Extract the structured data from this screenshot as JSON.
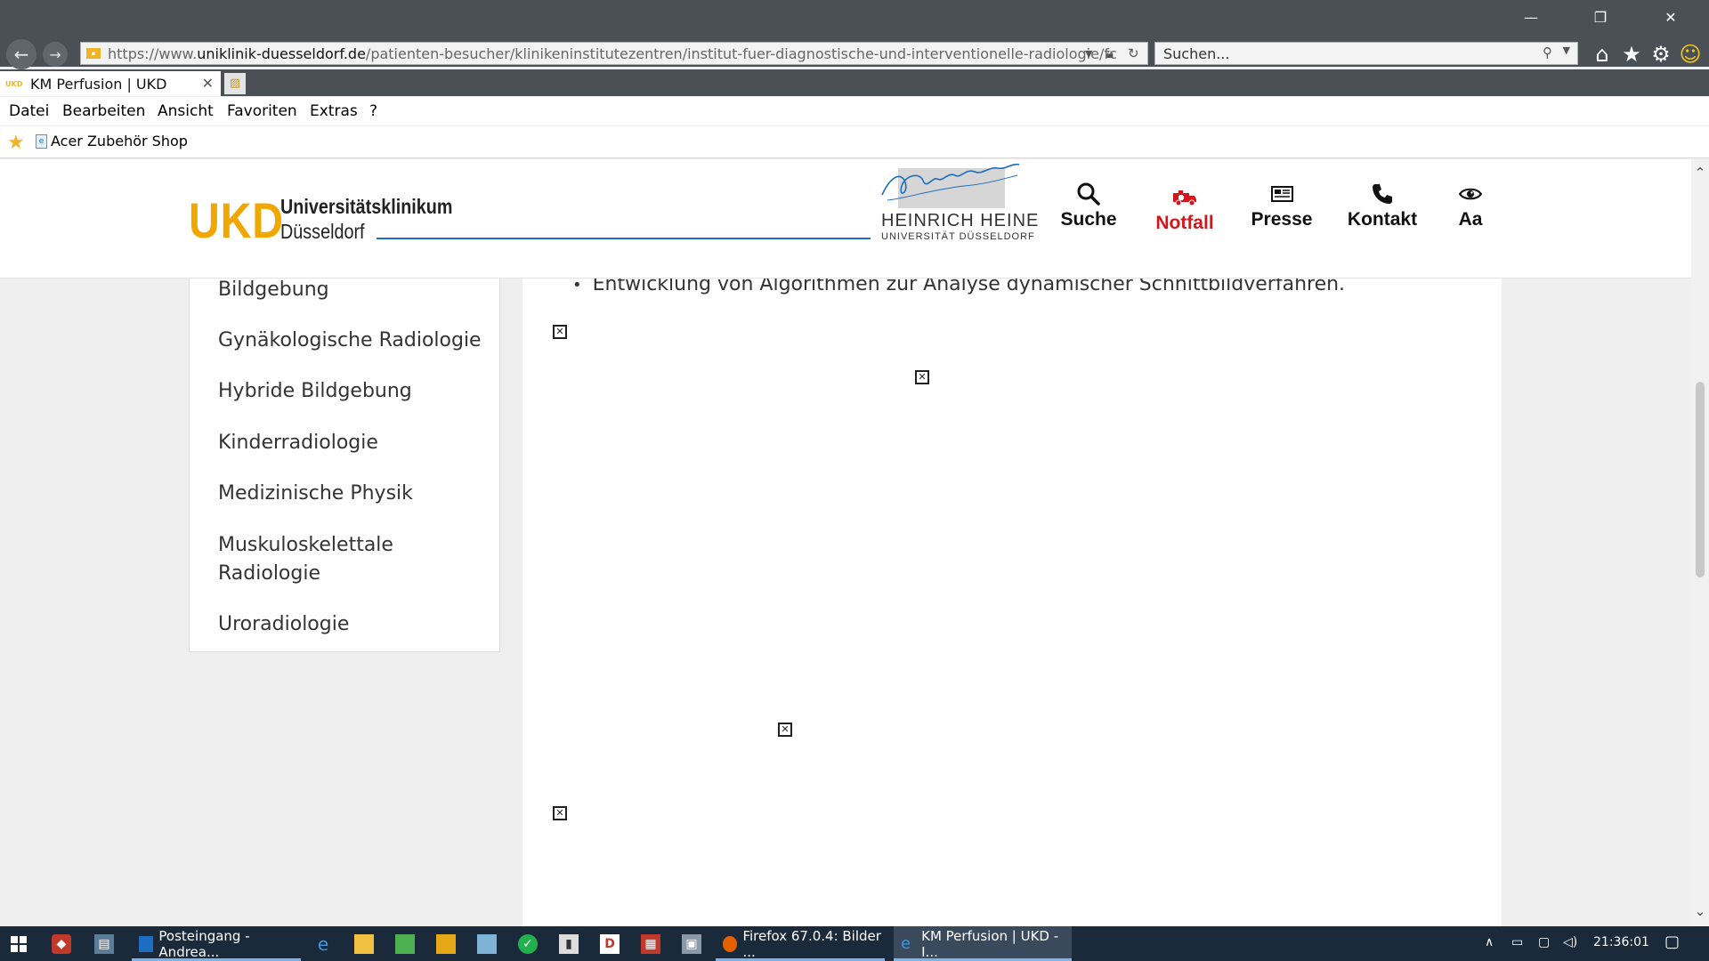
{
  "browser": {
    "url_prefix": "https://www.",
    "url_host": "uniklinik-duesseldorf.de",
    "url_path": "/patienten-besucher/klinikeninstitutezentren/institut-fuer-diagnostische-und-interventionelle-radiologie/fc",
    "search_placeholder": "Suchen...",
    "tab_title": "KM Perfusion | UKD",
    "tab_favicon": "UKD",
    "menu": [
      "Datei",
      "Bearbeiten",
      "Ansicht",
      "Favoriten",
      "Extras",
      "?"
    ],
    "favorites": [
      {
        "label": "Acer Zubehör Shop"
      }
    ]
  },
  "site": {
    "logo_mark": "UKD",
    "logo_line1": "Universitätsklinikum",
    "logo_line2": "Düsseldorf",
    "partner_name": "HEINRICH HEINE",
    "partner_sub": "UNIVERSITÄT DÜSSELDORF",
    "nav": [
      {
        "label": "Suche",
        "icon": "search-icon"
      },
      {
        "label": "Notfall",
        "icon": "ambulance-icon",
        "color": "#d4161c"
      },
      {
        "label": "Presse",
        "icon": "newspaper-icon"
      },
      {
        "label": "Kontakt",
        "icon": "phone-icon"
      },
      {
        "label": "Aa",
        "icon": "eye-icon"
      }
    ]
  },
  "sidebar": {
    "items": [
      "Bildgebung",
      "Gynäkologische Radiologie",
      "Hybride Bildgebung",
      "Kinderradiologie",
      "Medizinische Physik",
      "Muskuloskelettale Radiologie",
      "Uroradiologie"
    ]
  },
  "main": {
    "bullet_text": "Entwicklung von Algorithmen zur Analyse dynamischer Schnittbildverfahren."
  },
  "taskbar": {
    "tasks": [
      {
        "label": "Posteingang - Andrea..."
      },
      {
        "label": "Firefox 67.0.4: Bilder ..."
      },
      {
        "label": "KM Perfusion | UKD - I..."
      }
    ],
    "clock": "21:36:01"
  },
  "colors": {
    "brand": "#f0a800",
    "accent_blue": "#1d6dc1",
    "emergency": "#d4161c"
  }
}
